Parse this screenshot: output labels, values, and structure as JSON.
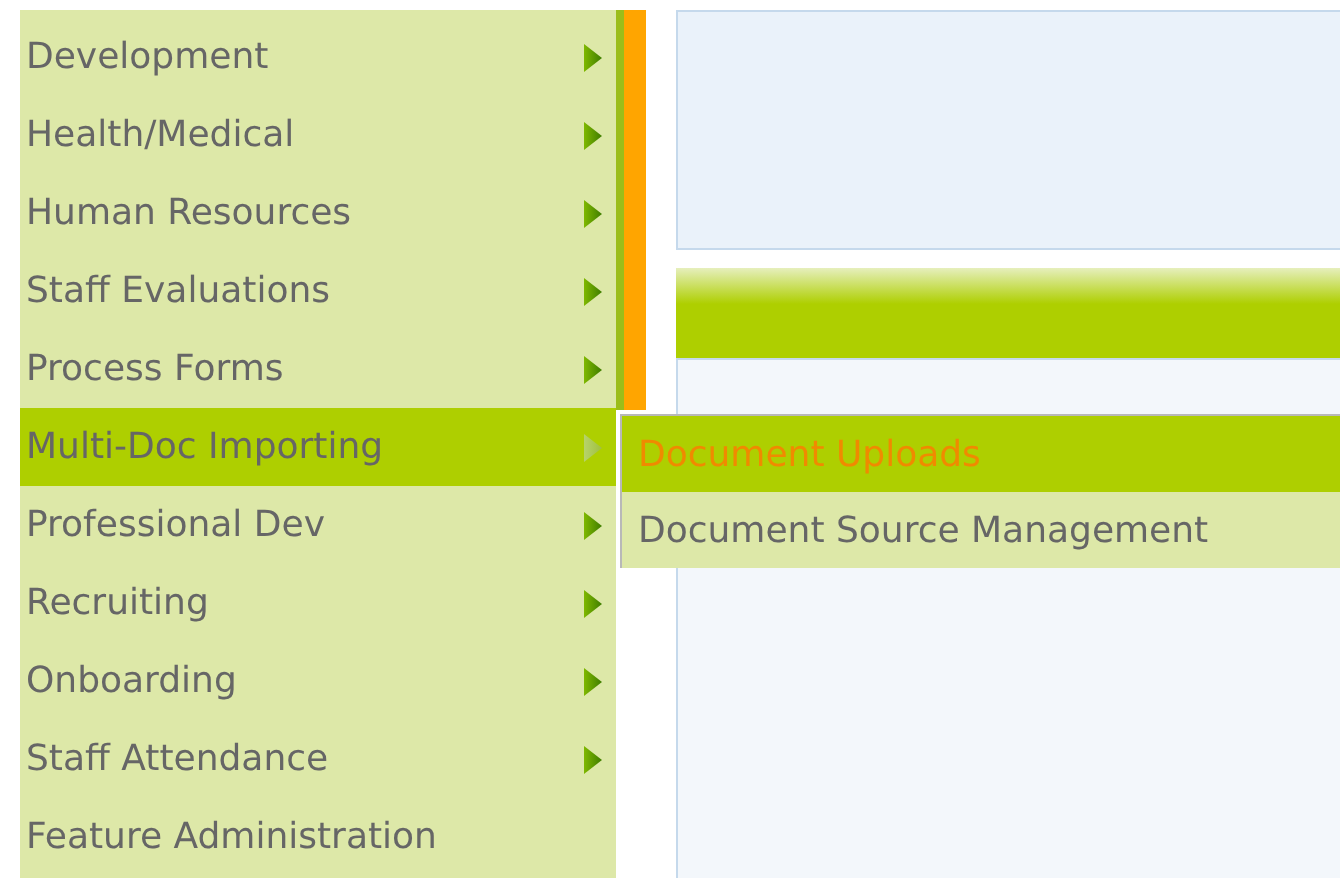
{
  "menu": {
    "items": [
      {
        "label": "Development",
        "has_submenu": true,
        "selected": false
      },
      {
        "label": "Health/Medical",
        "has_submenu": true,
        "selected": false
      },
      {
        "label": "Human Resources",
        "has_submenu": true,
        "selected": false
      },
      {
        "label": "Staff Evaluations",
        "has_submenu": true,
        "selected": false
      },
      {
        "label": "Process Forms",
        "has_submenu": true,
        "selected": false
      },
      {
        "label": "Multi-Doc Importing",
        "has_submenu": true,
        "selected": true
      },
      {
        "label": "Professional Dev",
        "has_submenu": true,
        "selected": false
      },
      {
        "label": "Recruiting",
        "has_submenu": true,
        "selected": false
      },
      {
        "label": "Onboarding",
        "has_submenu": true,
        "selected": false
      },
      {
        "label": "Staff Attendance",
        "has_submenu": true,
        "selected": false
      },
      {
        "label": "Feature Administration",
        "has_submenu": false,
        "selected": false
      }
    ]
  },
  "submenu": {
    "items": [
      {
        "label": "Document Uploads",
        "selected": true
      },
      {
        "label": "Document Source Management",
        "selected": false
      }
    ]
  }
}
